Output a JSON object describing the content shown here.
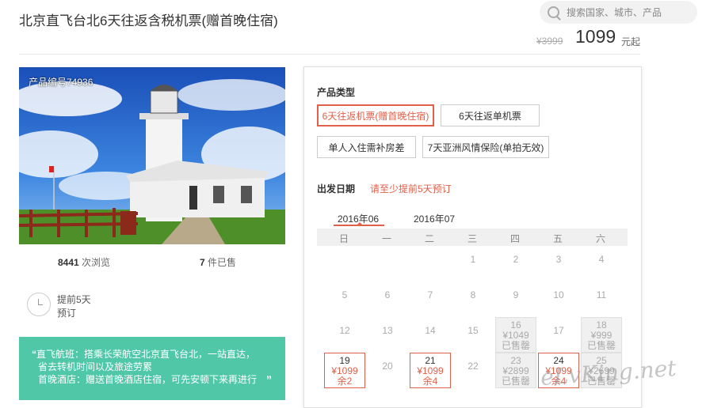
{
  "header": {
    "title": "北京直飞台北6天往返含税机票(赠首晚住宿)",
    "search_placeholder": "搜索国家、城市、产品",
    "old_price": "¥3999",
    "price": "1099",
    "price_suffix": "元起"
  },
  "left": {
    "product_no": "产品编号74936",
    "views_count": "8441",
    "views_label": "次浏览",
    "sold_count": "7",
    "sold_label": "件已售",
    "advance_line1": "提前5天",
    "advance_line2": "预订",
    "note_line1": "直飞航班：搭乘长荣航空北京直飞台北，一站直达，",
    "note_line2": "省去转机时间以及旅途劳累",
    "note_line3": "首晚酒店：赠送首晚酒店住宿，可先安顿下来再进行"
  },
  "product_types": {
    "label": "产品类型",
    "options": [
      "6天往返机票(赠首晚住宿)",
      "6天往返单机票",
      "单人入住需补房差",
      "7天亚洲风情保险(单拍无效)"
    ],
    "selected_index": 0
  },
  "departure": {
    "label": "出发日期",
    "note": "请至少提前5天预订",
    "months": [
      "2016年06",
      "2016年07"
    ],
    "selected_month": 0,
    "weekdays": [
      "日",
      "一",
      "二",
      "三",
      "四",
      "五",
      "六"
    ]
  },
  "calendar": {
    "rows": [
      [
        "",
        "",
        "",
        "1",
        "2",
        "3",
        "4"
      ],
      [
        "5",
        "6",
        "7",
        "8",
        "9",
        "10",
        "11"
      ],
      [
        "12",
        "13",
        "14",
        "15",
        "16",
        "17",
        "18"
      ],
      [
        "19",
        "20",
        "21",
        "22",
        "23",
        "24",
        "25"
      ]
    ],
    "cells": {
      "16": {
        "price": "¥1049",
        "status": "已售罄"
      },
      "18": {
        "price": "¥999",
        "status": "已售罄"
      },
      "19": {
        "price": "¥1099",
        "status": "余2"
      },
      "21": {
        "price": "¥1099",
        "status": "余4"
      },
      "23": {
        "price": "¥2899",
        "status": "已售罄"
      },
      "24": {
        "price": "¥1099",
        "status": "余4"
      },
      "25": {
        "price": "¥2699",
        "status": "已售罄"
      }
    }
  },
  "watermark": "eLvKing.net",
  "colors": {
    "accent": "#e0604a",
    "green": "#50c8a8"
  }
}
